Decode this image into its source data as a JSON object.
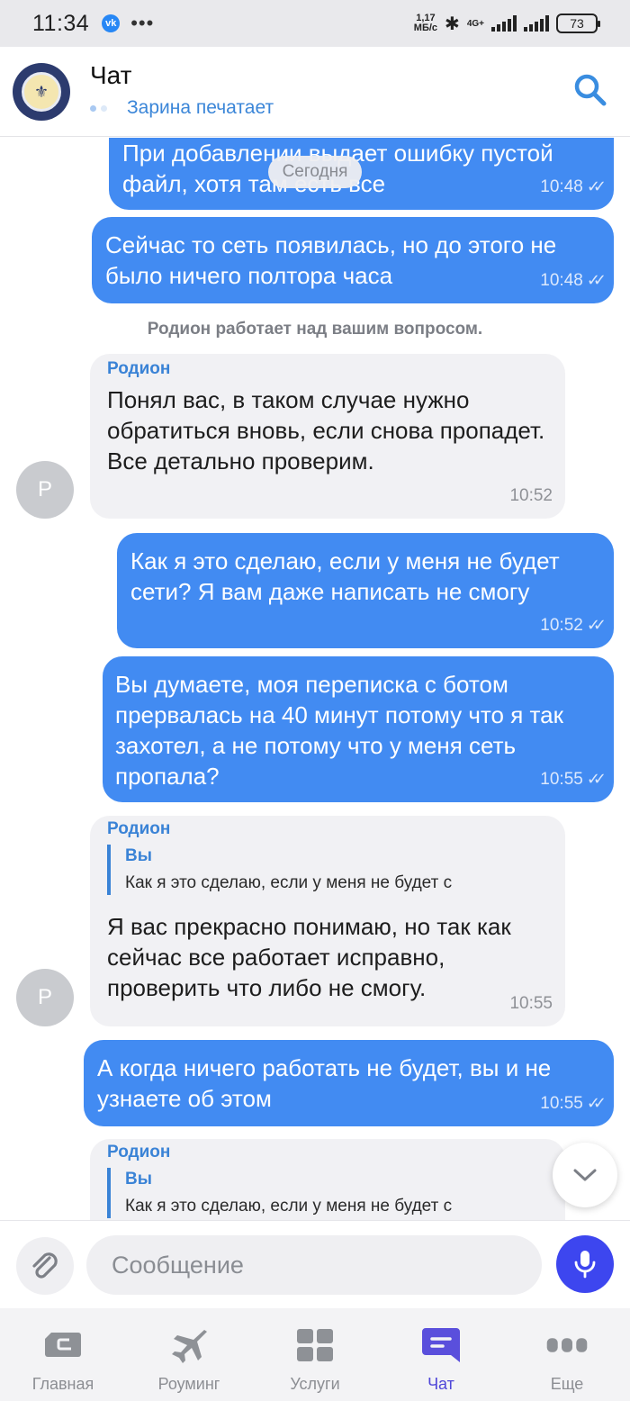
{
  "status_bar": {
    "time": "11:34",
    "app_badge": "vk",
    "overflow": "•••",
    "speed_value": "1,17",
    "speed_unit": "МБ/с",
    "network": "4G+",
    "battery": "73"
  },
  "header": {
    "title": "Чат",
    "typing_status": "Зарина печатает",
    "avatar_icon": "bank-emblem-icon",
    "search_icon": "search-icon"
  },
  "chat": {
    "date_label": "Сегодня",
    "system_message": "Родион  работает над вашим вопросом.",
    "agent_initial": "Р",
    "messages": [
      {
        "direction": "out",
        "text": "При добавлении выдает ошибку пустой файл, хотя там есть все",
        "time": "10:48"
      },
      {
        "direction": "out",
        "text": "Сейчас то сеть появилась, но до этого не было ничего полтора часа",
        "time": "10:48"
      },
      {
        "direction": "in",
        "sender": "Родион",
        "text": "Понял вас, в таком случае нужно обратиться вновь, если снова пропадет. Все детально проверим.",
        "time": "10:52"
      },
      {
        "direction": "out",
        "text": "Как я это сделаю, если у меня не будет сети? Я вам даже написать не смогу",
        "time": "10:52"
      },
      {
        "direction": "out",
        "text": "Вы думаете, моя переписка с ботом прервалась на 40 минут потому что я так захотел, а не потому что у меня сеть пропала?",
        "time": "10:55"
      },
      {
        "direction": "in",
        "sender": "Родион",
        "quote_author": "Вы",
        "quote_text": "Как я это сделаю, если у меня не будет с",
        "text": "Я вас прекрасно понимаю, но так как сейчас все работает исправно, проверить что либо не смогу.",
        "time": "10:55"
      },
      {
        "direction": "out",
        "text": "А когда ничего работать не будет, вы и не узнаете об этом",
        "time": "10:55"
      },
      {
        "direction": "in",
        "sender": "Родион",
        "quote_author": "Вы",
        "quote_text": "Как я это сделаю, если у меня не будет с"
      }
    ]
  },
  "composer": {
    "placeholder": "Сообщение",
    "attach_icon": "paperclip-icon",
    "mic_icon": "microphone-icon"
  },
  "bottom_nav": {
    "items": [
      {
        "label": "Главная",
        "icon": "home-card-icon",
        "active": false
      },
      {
        "label": "Роуминг",
        "icon": "airplane-icon",
        "active": false
      },
      {
        "label": "Услуги",
        "icon": "grid-icon",
        "active": false
      },
      {
        "label": "Чат",
        "icon": "chat-icon",
        "active": true
      },
      {
        "label": "Еще",
        "icon": "more-icon",
        "active": false
      }
    ]
  },
  "colors": {
    "outgoing_bubble": "#428bf2",
    "incoming_bubble": "#f1f1f4",
    "accent": "#3a83d6",
    "mic_button": "#3d46ef",
    "active_nav": "#4f46d8"
  }
}
